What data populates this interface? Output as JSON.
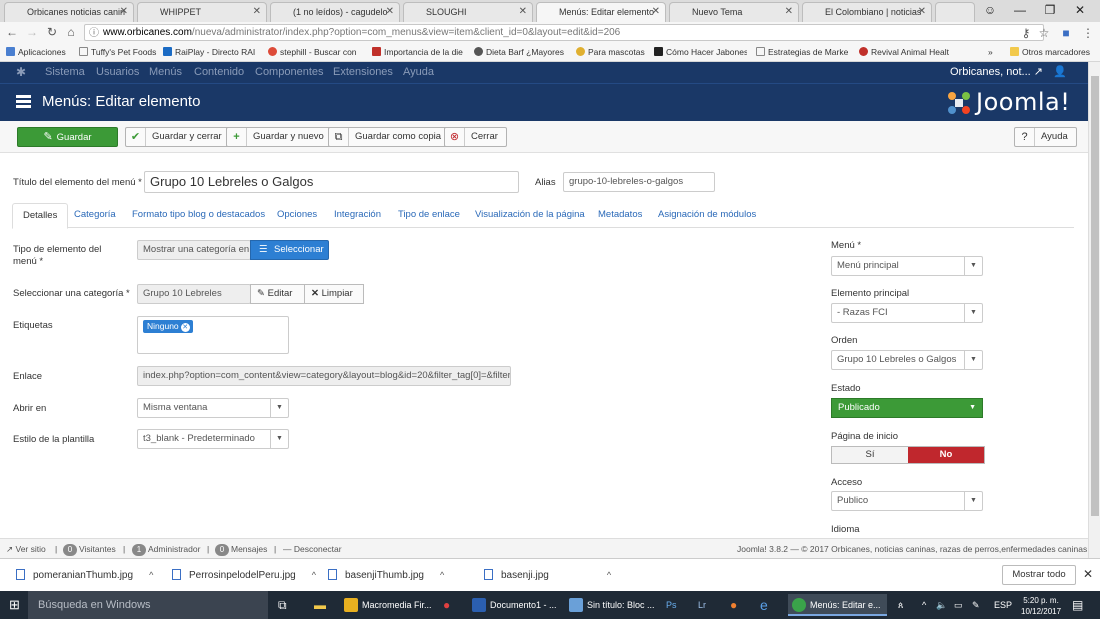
{
  "browser": {
    "tabs": [
      {
        "label": "Orbicanes noticias canin",
        "color": "#e0a030"
      },
      {
        "label": "WHIPPET",
        "color": "#9aa8c0"
      },
      {
        "label": "(1 no leídos) - cagudelo",
        "color": "#6a4db0"
      },
      {
        "label": "SLOUGHI",
        "color": "#e07a20"
      },
      {
        "label": "Menús: Editar elemento",
        "color": "#e0a030"
      },
      {
        "label": "Nuevo Tema",
        "color": "#d03030"
      },
      {
        "label": "El Colombiano | noticias",
        "color": "#444444"
      }
    ],
    "url_host": "www.orbicanes.com",
    "url_path": "/nueva/administrator/index.php?option=com_menus&view=item&client_id=0&layout=edit&id=206",
    "bookmarks": [
      "Aplicaciones",
      "Tuffy's Pet Foods",
      "RaiPlay - Directo RAI",
      "stephill - Buscar con",
      "Importancia de la die",
      "Dieta Barf ¿Mayores",
      "Para mascotas",
      "Cómo Hacer Jabones",
      "Estrategias de Marke",
      "Revival Animal Healt"
    ],
    "bookmarks_more": "»",
    "other_bookmarks": "Otros marcadores"
  },
  "admin_menu": {
    "items": [
      "Sistema",
      "Usuarios",
      "Menús",
      "Contenido",
      "Componentes",
      "Extensiones",
      "Ayuda"
    ],
    "site_name": "Orbicanes, not..."
  },
  "page": {
    "title": "Menús: Editar elemento",
    "logo_text": "Joomla!"
  },
  "toolbar": {
    "save": "Guardar",
    "save_close": "Guardar y cerrar",
    "save_new": "Guardar y nuevo",
    "save_copy": "Guardar como copia",
    "close": "Cerrar",
    "help": "Ayuda"
  },
  "form": {
    "title_label": "Título del elemento del menú *",
    "title_value": "Grupo 10 Lebreles o Galgos",
    "alias_label": "Alias",
    "alias_value": "grupo-10-lebreles-o-galgos",
    "tabs": [
      "Detalles",
      "Categoría",
      "Formato tipo blog o destacados",
      "Opciones",
      "Integración",
      "Tipo de enlace",
      "Visualización de la página",
      "Metadatos",
      "Asignación de módulos"
    ],
    "type_label": "Tipo de elemento del menú *",
    "type_value": "Mostrar una categoría en",
    "type_button": "Seleccionar",
    "category_label": "Seleccionar una categoría *",
    "category_value": "Grupo 10 Lebreles",
    "edit_button": "Editar",
    "clear_button": "Limpiar",
    "tags_label": "Etiquetas",
    "tag_value": "Ninguno",
    "link_label": "Enlace",
    "link_value": "index.php?option=com_content&view=category&layout=blog&id=20&filter_tag[0]=&filter_tag",
    "open_label": "Abrir en",
    "open_value": "Misma ventana",
    "template_label": "Estilo de la plantilla",
    "template_value": "t3_blank - Predeterminado"
  },
  "sidebar": {
    "menu_label": "Menú *",
    "menu_value": "Menú principal",
    "parent_label": "Elemento principal",
    "parent_value": "- Razas FCI",
    "order_label": "Orden",
    "order_value": "Grupo 10 Lebreles o Galgos",
    "state_label": "Estado",
    "state_value": "Publicado",
    "home_label": "Página de inicio",
    "home_yes": "Sí",
    "home_no": "No",
    "access_label": "Acceso",
    "access_value": "Publico",
    "language_label": "Idioma"
  },
  "statusbar": {
    "view_site": "Ver sitio",
    "visitors_count": "0",
    "visitors": "Visitantes",
    "admin_count": "1",
    "admin": "Administrador",
    "messages_count": "0",
    "messages": "Mensajes",
    "logout": "Desconectar",
    "copyright": "Joomla! 3.8.2 — © 2017 Orbicanes, noticias caninas, razas de perros,enfermedades caninas"
  },
  "downloads": {
    "files": [
      "pomeranianThumb.jpg",
      "PerrosinpelodelPeru.jpg",
      "basenjiThumb.jpg",
      "basenji.jpg"
    ],
    "show_all": "Mostrar todo"
  },
  "taskbar": {
    "search": "Búsqueda en Windows",
    "apps": [
      {
        "label": "Macromedia Fir...",
        "color": "#e8b020"
      },
      {
        "label": "Documento1 - ...",
        "color": "#2b5fb0"
      },
      {
        "label": "Sin título: Bloc ...",
        "color": "#6aa0d8"
      },
      {
        "label": "Menús: Editar e...",
        "color": "#3aa34a"
      }
    ],
    "lang": "ESP",
    "time": "5:20 p. m.",
    "date": "10/12/2017"
  }
}
